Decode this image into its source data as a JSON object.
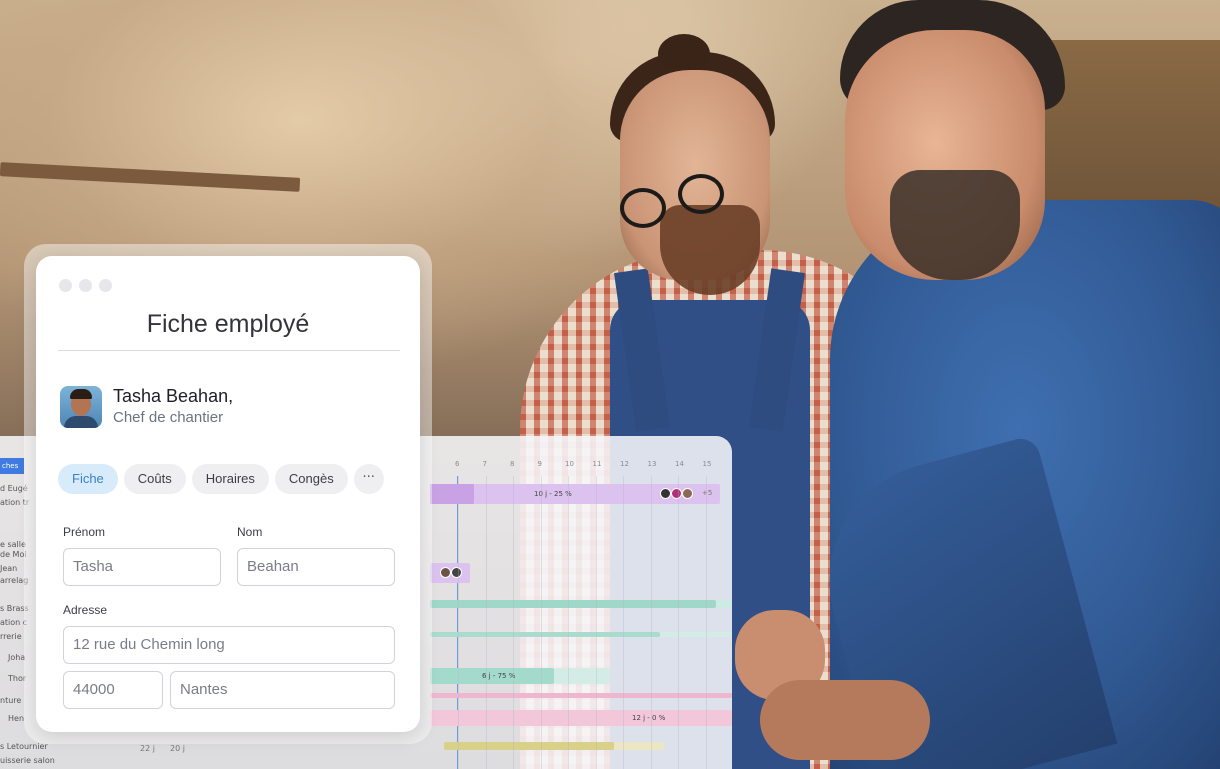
{
  "card": {
    "title": "Fiche employé",
    "employee": {
      "name": "Tasha Beahan,",
      "role": "Chef de chantier"
    },
    "tabs": [
      "Fiche",
      "Coûts",
      "Horaires",
      "Congès"
    ],
    "more_label": "···",
    "form": {
      "prenom_label": "Prénom",
      "prenom_value": "Tasha",
      "nom_label": "Nom",
      "nom_value": "Beahan",
      "adresse_label": "Adresse",
      "adresse_value": "12 rue du Chemin long",
      "code_postal_value": "44000",
      "ville_value": "Nantes"
    }
  },
  "gantt": {
    "days": [
      "6",
      "7",
      "8",
      "9",
      "10",
      "11",
      "12",
      "13",
      "14",
      "15"
    ],
    "left_tab": "ches",
    "left_labels": [
      "d Eugé",
      "ation tr",
      "de Moi",
      "e salle",
      "Jean",
      "arrelag",
      "s Brass",
      "ation c",
      "rrerie",
      "Joha",
      "Thor",
      "nture",
      "Hen",
      "s Letournier",
      "uisserie salon"
    ],
    "bar_labels": {
      "first": "10 j - 25 %",
      "extra": "+5",
      "second": "6 j - 75 %",
      "third": "12 j - 0 %"
    },
    "bottom_numbers": [
      "22 j",
      "20 j"
    ],
    "colors": {
      "purple": "#d7b8ec",
      "teal": "#9fd8c9",
      "pink": "#efb7cf",
      "olive": "#d9d08a",
      "today": "#6b9be8"
    }
  }
}
